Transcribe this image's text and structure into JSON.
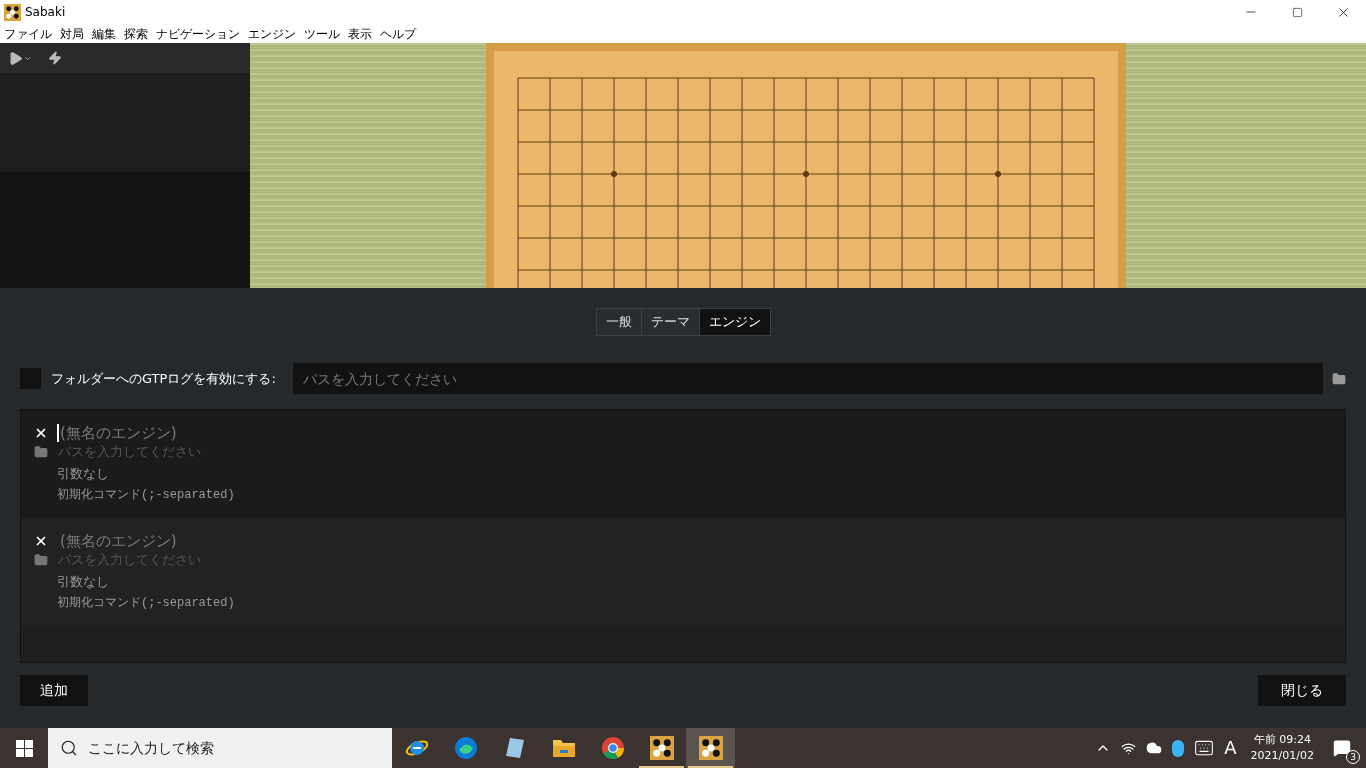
{
  "window": {
    "title": "Sabaki"
  },
  "menu": [
    "ファイル",
    "対局",
    "編集",
    "探索",
    "ナビゲーション",
    "エンジン",
    "ツール",
    "表示",
    "ヘルプ"
  ],
  "tabs": [
    {
      "label": "一般",
      "selected": false
    },
    {
      "label": "テーマ",
      "selected": false
    },
    {
      "label": "エンジン",
      "selected": true
    }
  ],
  "gtp_log": {
    "checked": false,
    "label": "フォルダーへのGTPログを有効にする:",
    "placeholder": "パスを入力してください"
  },
  "engines": [
    {
      "name_placeholder": "(無名のエンジン)",
      "focused": true,
      "path_placeholder": "パスを入力してください",
      "args_placeholder": "引数なし",
      "commands_placeholder": "初期化コマンド(;-separated)"
    },
    {
      "name_placeholder": "(無名のエンジン)",
      "focused": false,
      "path_placeholder": "パスを入力してください",
      "args_placeholder": "引数なし",
      "commands_placeholder": "初期化コマンド(;-separated)"
    }
  ],
  "buttons": {
    "add": "追加",
    "close": "閉じる"
  },
  "taskbar": {
    "search_placeholder": "ここに入力して検索",
    "apps": [
      {
        "kind": "ie",
        "running": false,
        "selected": false
      },
      {
        "kind": "edge",
        "running": false,
        "selected": false
      },
      {
        "kind": "notepad",
        "running": false,
        "selected": false
      },
      {
        "kind": "folder",
        "running": false,
        "selected": false
      },
      {
        "kind": "chrome",
        "running": false,
        "selected": false
      },
      {
        "kind": "go",
        "running": true,
        "selected": false
      },
      {
        "kind": "go",
        "running": true,
        "selected": true
      }
    ],
    "ime": "A",
    "time": "午前 09:24",
    "date": "2021/01/02",
    "notifications": "3"
  }
}
